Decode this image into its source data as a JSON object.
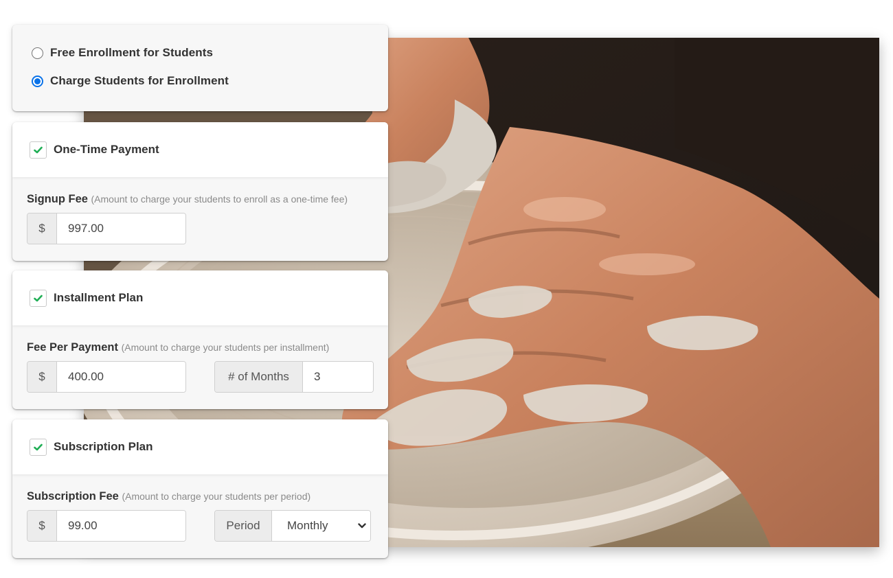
{
  "enrollment": {
    "options": [
      {
        "label": "Free Enrollment for Students",
        "selected": false
      },
      {
        "label": "Charge Students for Enrollment",
        "selected": true
      }
    ]
  },
  "plans": {
    "one_time": {
      "title": "One-Time Payment",
      "checked": true,
      "field_label": "Signup Fee",
      "field_hint": "(Amount to charge your students to enroll as a one-time fee)",
      "currency_symbol": "$",
      "amount": "997.00"
    },
    "installment": {
      "title": "Installment Plan",
      "checked": true,
      "field_label": "Fee Per Payment",
      "field_hint": "(Amount to charge your students per installment)",
      "currency_symbol": "$",
      "amount": "400.00",
      "months_label": "# of Months",
      "months_value": "3"
    },
    "subscription": {
      "title": "Subscription Plan",
      "checked": true,
      "field_label": "Subscription Fee",
      "field_hint": "(Amount to charge your students per period)",
      "currency_symbol": "$",
      "amount": "99.00",
      "period_label": "Period",
      "period_value": "Monthly"
    }
  },
  "colors": {
    "radio_selected": "#0a72e8",
    "checkmark": "#1fae55",
    "card_background": "#f7f7f7"
  },
  "photo": {
    "subject": "hands shaping clay on a pottery wheel"
  }
}
